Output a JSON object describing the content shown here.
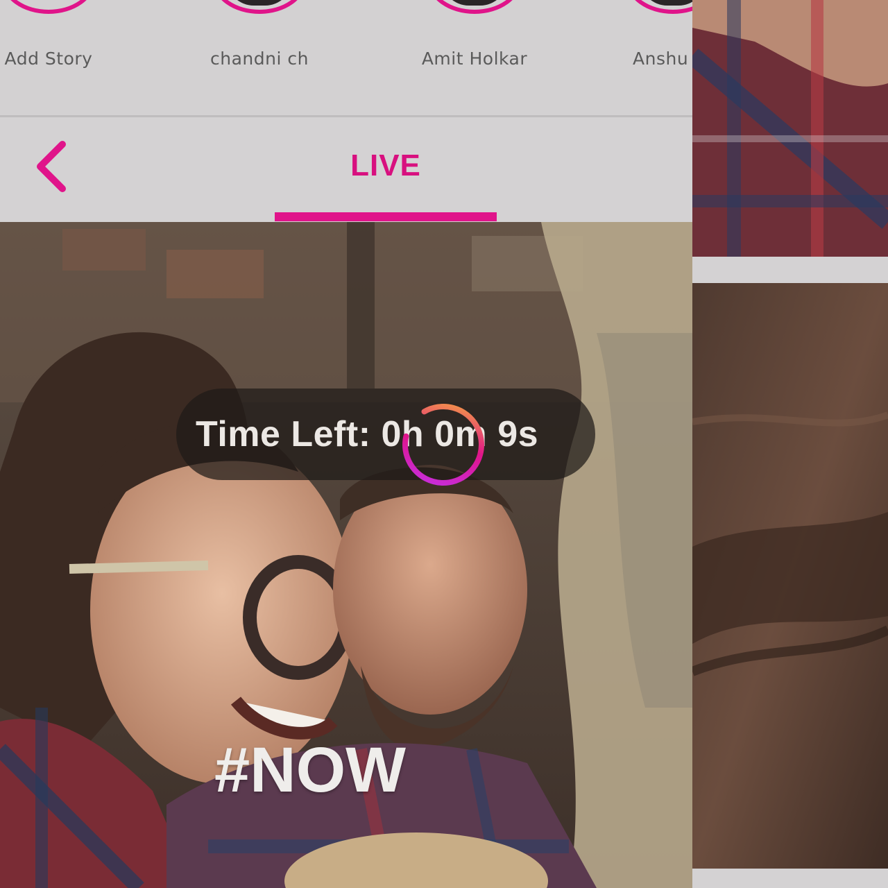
{
  "stories": [
    {
      "name": "Add Story"
    },
    {
      "name": "chandni ch"
    },
    {
      "name": "Amit Holkar"
    },
    {
      "name": "Anshu"
    }
  ],
  "header": {
    "tab_label": "LIVE"
  },
  "live": {
    "timer_text": "Time Left: 0h 0m 9s",
    "hashtag": "#NOW"
  },
  "colors": {
    "accent": "#e0148a",
    "background": "#d3d1d2"
  },
  "icons": {
    "back": "chevron-left-icon",
    "loading": "loading-spinner-icon"
  }
}
